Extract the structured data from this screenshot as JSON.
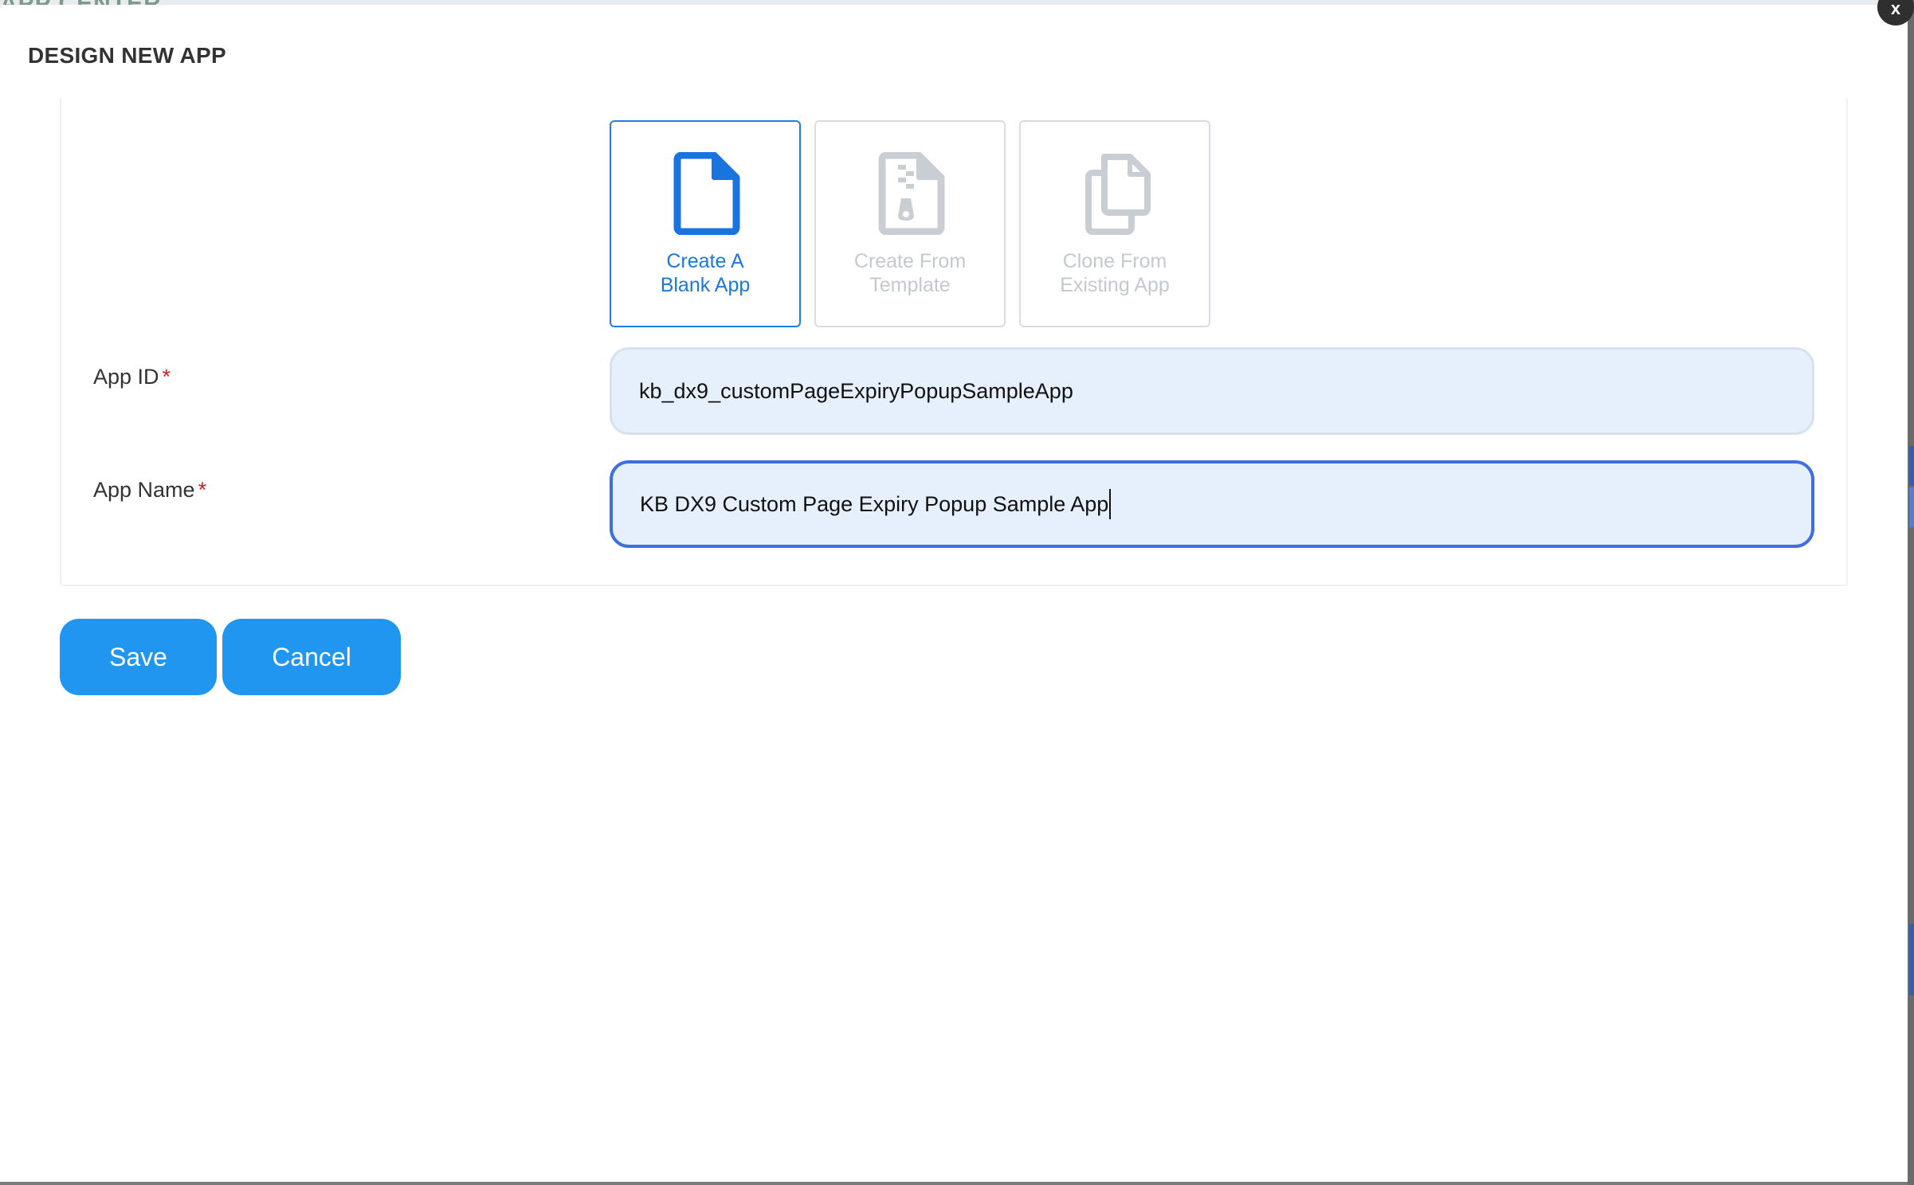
{
  "background": {
    "header_text": "APP CENTER"
  },
  "modal": {
    "title": "DESIGN NEW APP",
    "close_label": "x"
  },
  "app_types": [
    {
      "line1": "Create A",
      "line2": "Blank App",
      "icon": "blank-file-icon",
      "selected": true
    },
    {
      "line1": "Create From",
      "line2": "Template",
      "icon": "zip-file-icon",
      "selected": false
    },
    {
      "line1": "Clone From",
      "line2": "Existing App",
      "icon": "copy-icon",
      "selected": false
    }
  ],
  "fields": {
    "app_id": {
      "label": "App ID",
      "required_mark": "*",
      "value": "kb_dx9_customPageExpiryPopupSampleApp"
    },
    "app_name": {
      "label": "App Name",
      "required_mark": "*",
      "value": "KB DX9 Custom Page Expiry Popup Sample App"
    }
  },
  "actions": {
    "save_label": "Save",
    "cancel_label": "Cancel"
  },
  "colors": {
    "accent": "#2196f0",
    "selected_card": "#1e7fe0",
    "input_bg": "#e6effc",
    "required": "#d42020"
  }
}
